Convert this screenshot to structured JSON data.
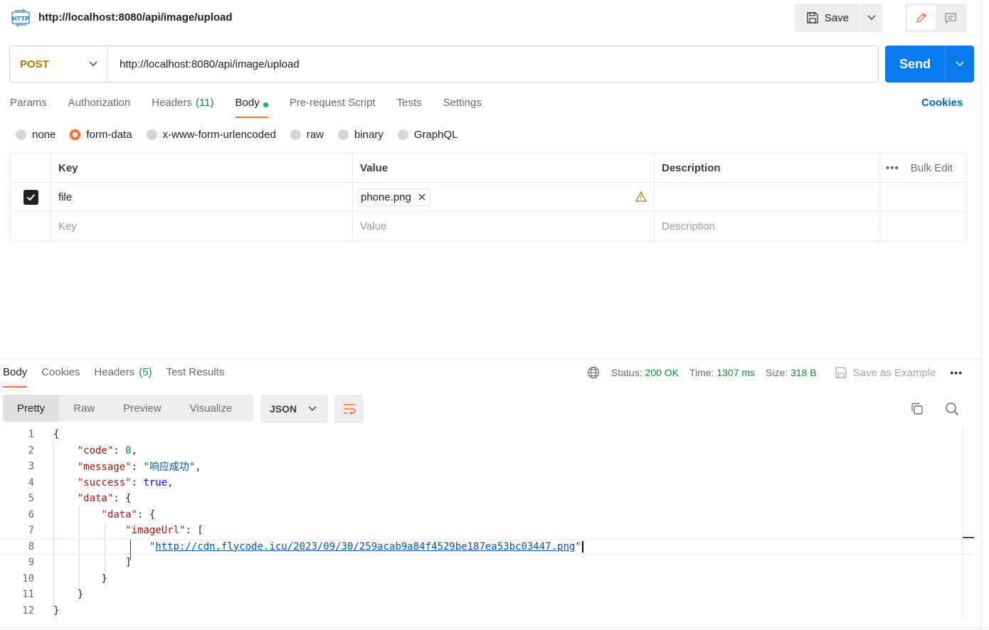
{
  "header": {
    "tab_title": "http://localhost:8080/api/image/upload",
    "save_label": "Save"
  },
  "request": {
    "method": "POST",
    "url": "http://localhost:8080/api/image/upload",
    "send_label": "Send",
    "tabs": [
      {
        "label": "Params"
      },
      {
        "label": "Authorization"
      },
      {
        "label": "Headers",
        "count": "(11)"
      },
      {
        "label": "Body"
      },
      {
        "label": "Pre-request Script"
      },
      {
        "label": "Tests"
      },
      {
        "label": "Settings"
      }
    ],
    "cookies_label": "Cookies",
    "body_types": [
      "none",
      "form-data",
      "x-www-form-urlencoded",
      "raw",
      "binary",
      "GraphQL"
    ],
    "selected_body_type": "form-data"
  },
  "params_table": {
    "headers": {
      "key": "Key",
      "value": "Value",
      "description": "Description",
      "bulk_edit": "Bulk Edit"
    },
    "rows": [
      {
        "checked": true,
        "key": "file",
        "value": "phone.png",
        "description": ""
      }
    ],
    "placeholders": {
      "key": "Key",
      "value": "Value",
      "description": "Description"
    }
  },
  "response": {
    "tabs": [
      {
        "label": "Body"
      },
      {
        "label": "Cookies"
      },
      {
        "label": "Headers",
        "count": "(5)"
      },
      {
        "label": "Test Results"
      }
    ],
    "status_label": "Status:",
    "status_value": "200 OK",
    "time_label": "Time:",
    "time_value": "1307 ms",
    "size_label": "Size:",
    "size_value": "318 B",
    "save_example_label": "Save as Example",
    "view_modes": [
      "Pretty",
      "Raw",
      "Preview",
      "Visualize"
    ],
    "format": "JSON",
    "code_lines": [
      "{",
      "    \"code\": 0,",
      "    \"message\": \"响应成功\",",
      "    \"success\": true,",
      "    \"data\": {",
      "        \"data\": {",
      "            \"imageUrl\": [",
      "                \"http://cdn.flycode.icu/2023/09/30/259acab9a84f4529be187ea53bc03447.png\"",
      "            ]",
      "        }",
      "    }",
      "}"
    ]
  },
  "colors": {
    "accent": "#ff6c37",
    "send_blue": "#097bed",
    "method_post": "#ad7a03",
    "status_green": "#0f8a3b"
  }
}
